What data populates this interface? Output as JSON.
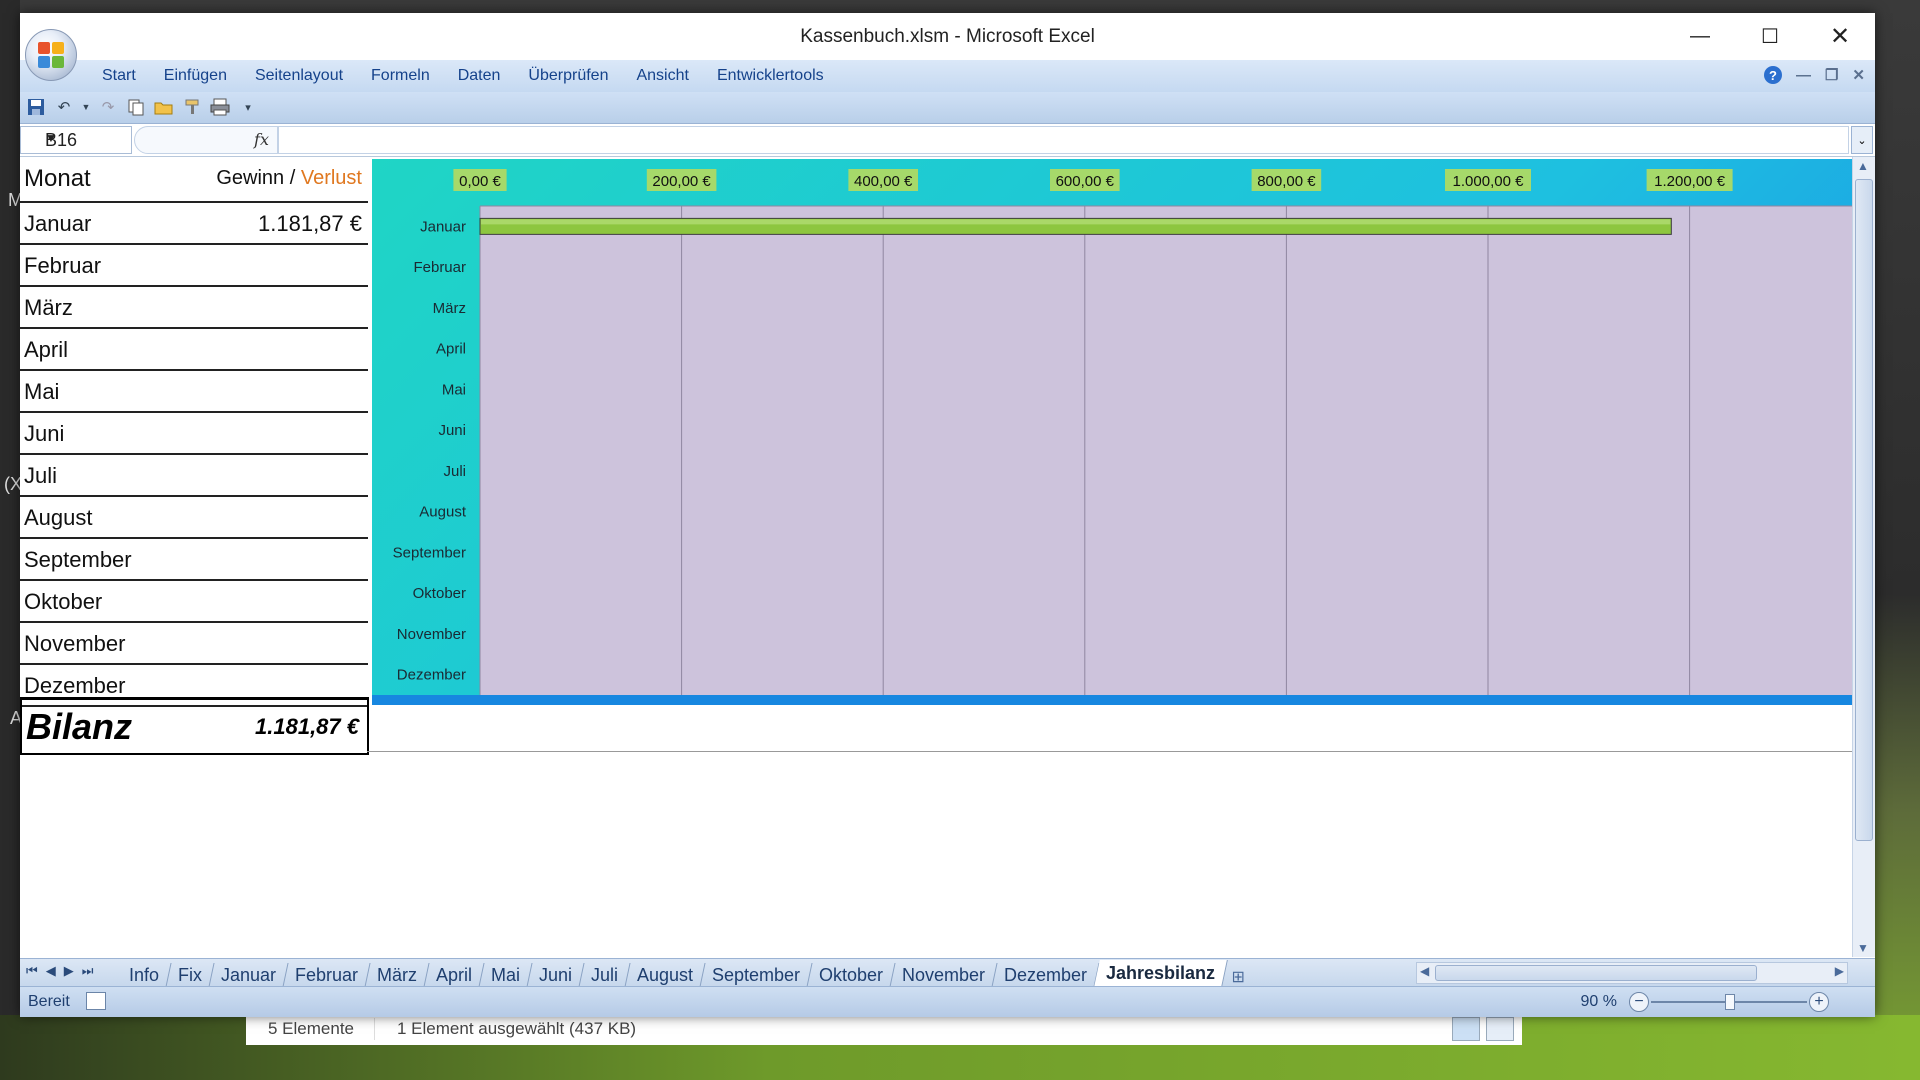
{
  "window": {
    "title": "Kassenbuch.xlsm - Microsoft Excel"
  },
  "menu": [
    "Start",
    "Einfügen",
    "Seitenlayout",
    "Formeln",
    "Daten",
    "Überprüfen",
    "Ansicht",
    "Entwicklertools"
  ],
  "formula_bar": {
    "name_box": "B16",
    "fx_label": "fx",
    "formula": ""
  },
  "table": {
    "header_month": "Monat",
    "header_gain": "Gewinn /",
    "header_loss": "Verlust",
    "rows": [
      {
        "month": "Januar",
        "value": "1.181,87 €"
      },
      {
        "month": "Februar",
        "value": ""
      },
      {
        "month": "März",
        "value": ""
      },
      {
        "month": "April",
        "value": ""
      },
      {
        "month": "Mai",
        "value": ""
      },
      {
        "month": "Juni",
        "value": ""
      },
      {
        "month": "Juli",
        "value": ""
      },
      {
        "month": "August",
        "value": ""
      },
      {
        "month": "September",
        "value": ""
      },
      {
        "month": "Oktober",
        "value": ""
      },
      {
        "month": "November",
        "value": ""
      },
      {
        "month": "Dezember",
        "value": ""
      }
    ],
    "bilanz_label": "Bilanz",
    "bilanz_value": "1.181,87 €"
  },
  "chart_data": {
    "type": "bar",
    "orientation": "horizontal",
    "categories": [
      "Januar",
      "Februar",
      "März",
      "April",
      "Mai",
      "Juni",
      "Juli",
      "August",
      "September",
      "Oktober",
      "November",
      "Dezember"
    ],
    "values": [
      1181.87,
      0,
      0,
      0,
      0,
      0,
      0,
      0,
      0,
      0,
      0,
      0
    ],
    "xlim": [
      0,
      1300
    ],
    "xticks": [
      0,
      200,
      400,
      600,
      800,
      1000,
      1200
    ],
    "xtick_labels": [
      "0,00 €",
      "200,00 €",
      "400,00 €",
      "600,00 €",
      "800,00 €",
      "1.000,00 €",
      "1.200,00 €"
    ],
    "grid": true,
    "axis_position": "top",
    "bar_color": "#8dc63f",
    "tick_label_bg": "#a6d96a",
    "plot_bg": "#cdc3dc"
  },
  "sheet_tabs": [
    "Info",
    "Fix",
    "Januar",
    "Februar",
    "März",
    "April",
    "Mai",
    "Juni",
    "Juli",
    "August",
    "September",
    "Oktober",
    "November",
    "Dezember",
    "Jahresbilanz"
  ],
  "active_tab": "Jahresbilanz",
  "status": {
    "ready": "Bereit",
    "zoom": "90 %"
  },
  "explorer": {
    "items": "5 Elemente",
    "selected": "1 Element ausgewählt (437 KB)"
  },
  "background_text": {
    "m": "M",
    "x": "(X",
    "a": "A"
  }
}
